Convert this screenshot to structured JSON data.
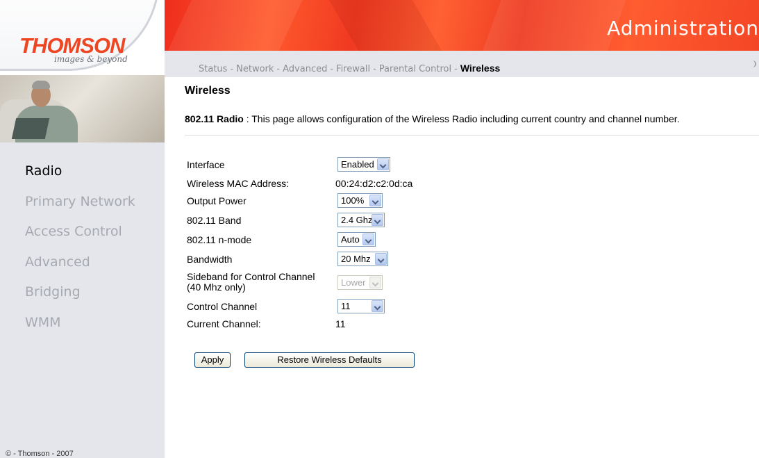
{
  "brand": {
    "logo_text": "THOMSON",
    "tagline": "images & beyond",
    "accent_color": "#ee4522"
  },
  "header": {
    "title": "Administration"
  },
  "tabs": [
    {
      "label": "Status"
    },
    {
      "label": "Network"
    },
    {
      "label": "Advanced"
    },
    {
      "label": "Firewall"
    },
    {
      "label": "Parental Control"
    },
    {
      "label": "Wireless",
      "active": true
    }
  ],
  "tab_separator": "-",
  "sidebar": {
    "items": [
      {
        "label": "Radio",
        "active": true
      },
      {
        "label": "Primary Network"
      },
      {
        "label": "Access Control"
      },
      {
        "label": "Advanced"
      },
      {
        "label": "Bridging"
      },
      {
        "label": "WMM"
      }
    ],
    "copyright": "© - Thomson - 2007"
  },
  "page": {
    "title": "Wireless",
    "desc_strong": "802.11 Radio",
    "desc_text": " :  This page allows configuration of the Wireless Radio including current country and channel number."
  },
  "form": {
    "interface": {
      "label": "Interface",
      "value": "Enabled"
    },
    "mac": {
      "label": "Wireless MAC Address:",
      "value": "00:24:d2:c2:0d:ca"
    },
    "output_power": {
      "label": "Output Power",
      "value": "100%"
    },
    "band": {
      "label": "802.11 Band",
      "value": "2.4 Ghz"
    },
    "nmode": {
      "label": "802.11 n-mode",
      "value": "Auto"
    },
    "bandwidth": {
      "label": "Bandwidth",
      "value": "20 Mhz"
    },
    "sideband": {
      "label_line1": "Sideband for Control Channel",
      "label_line2": "(40 Mhz only)",
      "value": "Lower",
      "disabled": true
    },
    "control_channel": {
      "label": "Control Channel",
      "value": "11"
    },
    "current_channel": {
      "label": "Current Channel:",
      "value": "11"
    }
  },
  "buttons": {
    "apply": "Apply",
    "restore": "Restore Wireless Defaults"
  }
}
